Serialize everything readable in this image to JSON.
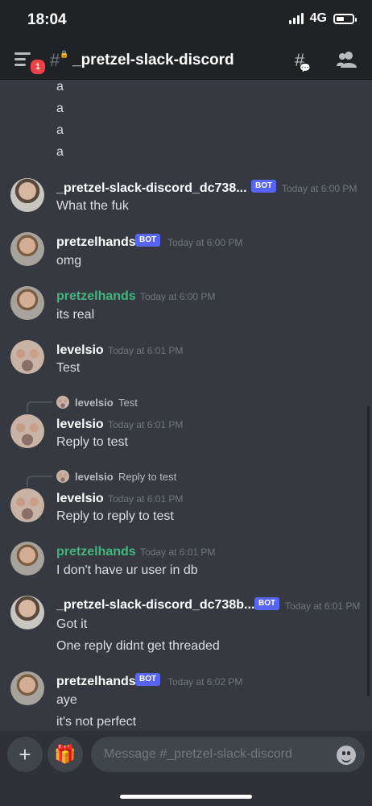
{
  "status_bar": {
    "time": "18:04",
    "network": "4G"
  },
  "header": {
    "unread_badge": "1",
    "channel_name": "_pretzel-slack-discord"
  },
  "bot_tag": "BOT",
  "messages": [
    {
      "text": "a"
    },
    {
      "text": "a"
    },
    {
      "text": "a"
    },
    {
      "text": "a"
    },
    {
      "author": "_pretzel-slack-discord_dc738...",
      "timestamp": "Today at 6:00 PM",
      "text": "What the fuk"
    },
    {
      "author": "pretzelhands",
      "timestamp": "Today at 6:00 PM",
      "text": "omg"
    },
    {
      "author": "pretzelhands",
      "timestamp": "Today at 6:00 PM",
      "text": "its real"
    },
    {
      "author": "levelsio",
      "timestamp": "Today at 6:01 PM",
      "text": "Test"
    },
    {
      "reply_author": "levelsio",
      "reply_text": "Test",
      "author": "levelsio",
      "timestamp": "Today at 6:01 PM",
      "text": "Reply to test"
    },
    {
      "reply_author": "levelsio",
      "reply_text": "Reply to test",
      "author": "levelsio",
      "timestamp": "Today at 6:01 PM",
      "text": "Reply to reply to test"
    },
    {
      "author": "pretzelhands",
      "timestamp": "Today at 6:01 PM",
      "text": "I don't have ur user in db"
    },
    {
      "author": "_pretzel-slack-discord_dc738b...",
      "timestamp": "Today at 6:01 PM",
      "text": "Got it",
      "text2": "One reply didnt get threaded"
    },
    {
      "author": "pretzelhands",
      "timestamp": "Today at 6:02 PM",
      "text": "aye",
      "text2": "it's not perfect"
    }
  ],
  "composer": {
    "placeholder": "Message #_pretzel-slack-discord"
  },
  "colors": {
    "background": "#36393f",
    "header": "#202225",
    "bot_tag": "#5865f2",
    "green_name": "#43b581"
  },
  "icons": [
    "menu-icon",
    "hash-lock-icon",
    "threads-icon",
    "members-icon",
    "plus-icon",
    "gift-icon",
    "emoji-icon"
  ]
}
